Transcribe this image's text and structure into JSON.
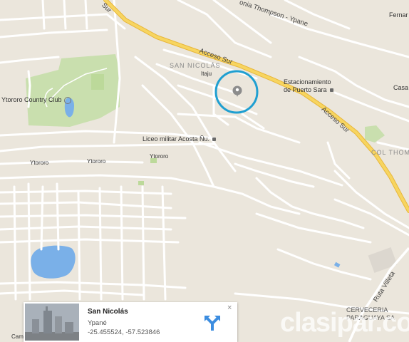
{
  "labels": {
    "road_acceso_sur_1": "Acceso Sur",
    "road_acceso_sur_2": "Acceso Sur",
    "road_sur_top": "Sur",
    "road_thompson": "onia Thompson - Ypane",
    "road_ruta_villeta": "Ruta Villeta",
    "area_san_nicolas": "SAN NICOLÁS",
    "area_col_thom": "COL THOM",
    "place_itaju": "Itaju",
    "place_ytororo_1": "Ytororo",
    "place_ytororo_2": "Ytororo",
    "place_ytororo_3": "Ytororo",
    "place_ferna": "Fernar",
    "place_casa": "Casa",
    "poi_country_club": "Ytororo Country Club",
    "poi_liceo": "Liceo militar Acosta Ñu.",
    "poi_estacionamiento_1": "Estacionamiento",
    "poi_estacionamiento_2": "de Puerto Sara",
    "poi_cerveceria_1": "CERVECERIA",
    "poi_cerveceria_2": "PARAGUAYA SA",
    "road_cam": "Cam"
  },
  "card": {
    "title": "San Nicolás",
    "subtitle": "Ypané",
    "coords": "-25.455524, -57.523846",
    "close": "×",
    "directions_icon": "directions-icon"
  },
  "watermark": "clasipar.com",
  "colors": {
    "land": "#ebe6dc",
    "road": "#ffffff",
    "highway": "#f5cc4a",
    "park": "#c9dfae",
    "water": "#7ab0e8",
    "marker_ring": "#1f9fd1"
  }
}
